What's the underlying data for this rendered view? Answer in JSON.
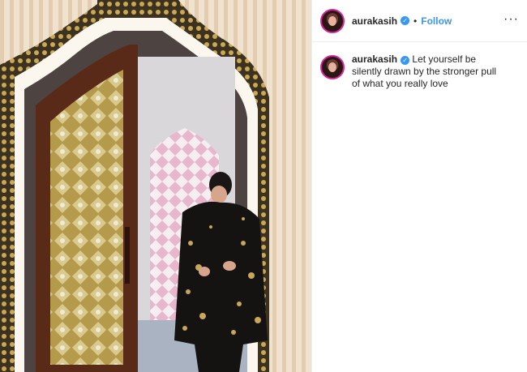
{
  "post": {
    "username": "aurakasih",
    "verified_icon": "verified-badge-icon",
    "separator": "•",
    "follow_label": "Follow",
    "more_icon": "more-options-icon",
    "more_glyph": "···",
    "caption": "Let yourself be silently drawn by the stronger pull of what you really love"
  },
  "colors": {
    "link_blue": "#3897f0",
    "text": "#262626",
    "story_ring": "#d6249f"
  }
}
